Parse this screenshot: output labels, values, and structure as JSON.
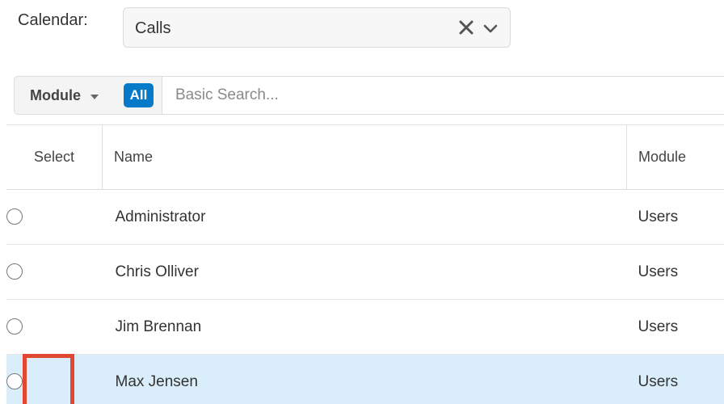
{
  "calendar": {
    "label": "Calendar:",
    "selected_value": "Calls"
  },
  "search": {
    "module_filter_label": "Module",
    "all_badge_label": "All",
    "placeholder": "Basic Search..."
  },
  "table": {
    "headers": {
      "select": "Select",
      "name": "Name",
      "module": "Module"
    },
    "rows": [
      {
        "name": "Administrator",
        "module": "Users",
        "selected": false
      },
      {
        "name": "Chris Olliver",
        "module": "Users",
        "selected": false
      },
      {
        "name": "Jim Brennan",
        "module": "Users",
        "selected": false
      },
      {
        "name": "Max Jensen",
        "module": "Users",
        "selected": true
      }
    ]
  },
  "colors": {
    "accent": "#0679c8",
    "selected_row": "#d9edfb",
    "highlight": "#e0482f"
  }
}
